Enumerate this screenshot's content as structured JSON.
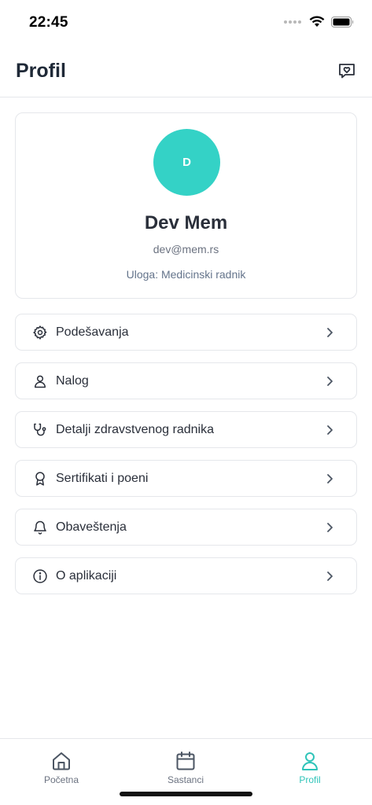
{
  "status": {
    "time": "22:45"
  },
  "header": {
    "title": "Profil"
  },
  "profile": {
    "initial": "D",
    "name": "Dev Mem",
    "email": "dev@mem.rs",
    "role": "Uloga: Medicinski radnik"
  },
  "menu": {
    "items": [
      {
        "label": "Podešavanja",
        "icon": "gear-icon"
      },
      {
        "label": "Nalog",
        "icon": "user-icon"
      },
      {
        "label": "Detalji zdravstvenog radnika",
        "icon": "stethoscope-icon"
      },
      {
        "label": "Sertifikati i poeni",
        "icon": "award-icon"
      },
      {
        "label": "Obaveštenja",
        "icon": "bell-icon"
      },
      {
        "label": "O aplikaciji",
        "icon": "info-icon"
      }
    ]
  },
  "tabs": [
    {
      "label": "Početna",
      "icon": "home-icon"
    },
    {
      "label": "Sastanci",
      "icon": "calendar-icon"
    },
    {
      "label": "Profil",
      "icon": "user-icon"
    }
  ],
  "colors": {
    "accent": "#34d2c6",
    "active_tab": "#2fc4b9",
    "text": "#2a2f3a",
    "muted": "#6b7280",
    "border": "#e5e7eb"
  }
}
